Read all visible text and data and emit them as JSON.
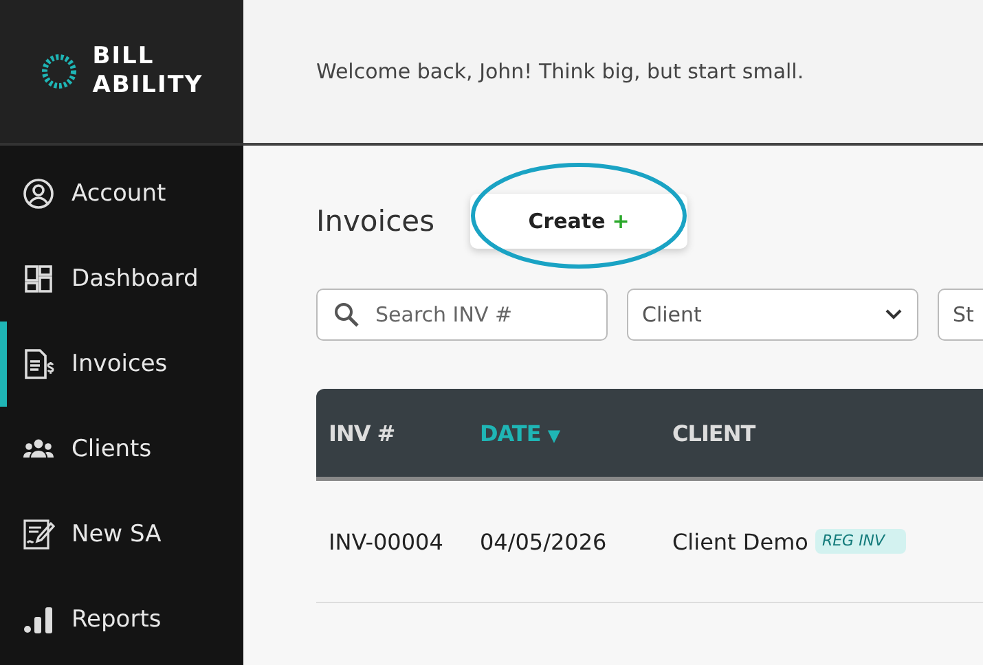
{
  "brand": {
    "line1": "BILL",
    "line2": "ABILITY"
  },
  "sidebar": {
    "items": [
      {
        "label": "Account",
        "selected": false
      },
      {
        "label": "Dashboard",
        "selected": false
      },
      {
        "label": "Invoices",
        "selected": true
      },
      {
        "label": "Clients",
        "selected": false
      },
      {
        "label": "New SA",
        "selected": false
      },
      {
        "label": "Reports",
        "selected": false
      }
    ]
  },
  "header": {
    "welcome": "Welcome back, John! Think big, but start small."
  },
  "page": {
    "title": "Invoices",
    "create_button": {
      "label": "Create",
      "plus": "+"
    }
  },
  "filters": [
    {
      "kind": "search",
      "placeholder": "Search INV #"
    },
    {
      "kind": "select",
      "placeholder": "Client"
    },
    {
      "kind": "select",
      "placeholder": "St"
    }
  ],
  "table": {
    "columns": [
      {
        "label": "INV #",
        "sorted": false
      },
      {
        "label": "DATE",
        "sorted": true,
        "sort_mark": "▼"
      },
      {
        "label": "CLIENT",
        "sorted": false
      }
    ],
    "rows": [
      {
        "inv": "INV-00004",
        "date": "04/05/2026",
        "client": "Client Demo",
        "tag": {
          "label": "REG INV",
          "color": "#d3f2f0"
        }
      }
    ]
  }
}
